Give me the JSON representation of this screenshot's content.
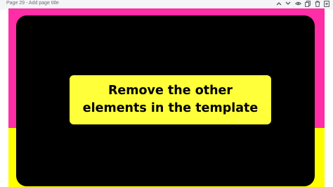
{
  "header": {
    "page_title": "Page 29 - Add page title"
  },
  "toolbar": {
    "icons": [
      "chevron-up-icon",
      "chevron-down-icon",
      "hide-icon",
      "copy-icon",
      "trash-icon",
      "add-page-icon"
    ]
  },
  "slide": {
    "caption": "Remove the other elements in the template",
    "colors": {
      "background_top": "#ff2da6",
      "background_bottom": "#ffff00",
      "panel": "#000000",
      "caption_box": "#ffff3a"
    }
  }
}
